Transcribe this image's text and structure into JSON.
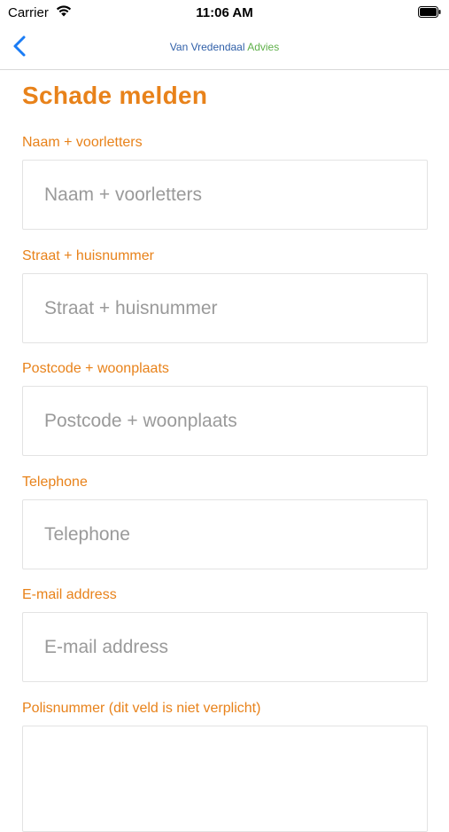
{
  "status_bar": {
    "carrier": "Carrier",
    "time": "11:06 AM",
    "icons": [
      "wifi-icon",
      "battery-icon"
    ]
  },
  "nav": {
    "back_icon": "chevron-left-icon",
    "logo_part_1": "Van Vredendaal",
    "logo_part_2": "Advies",
    "accent_blue": "#2f5fa8",
    "accent_green": "#5fb04a"
  },
  "form": {
    "title": "Schade melden",
    "accent_color": "#e8821a",
    "fields": [
      {
        "label": "Naam + voorletters",
        "placeholder": "Naam + voorletters",
        "value": ""
      },
      {
        "label": "Straat + huisnummer",
        "placeholder": "Straat + huisnummer",
        "value": ""
      },
      {
        "label": "Postcode + woonplaats",
        "placeholder": "Postcode + woonplaats",
        "value": ""
      },
      {
        "label": "Telephone",
        "placeholder": "Telephone",
        "value": ""
      },
      {
        "label": "E-mail address",
        "placeholder": "E-mail address",
        "value": ""
      },
      {
        "label": "Polisnummer (dit veld is niet verplicht)",
        "placeholder": "",
        "value": ""
      }
    ]
  }
}
